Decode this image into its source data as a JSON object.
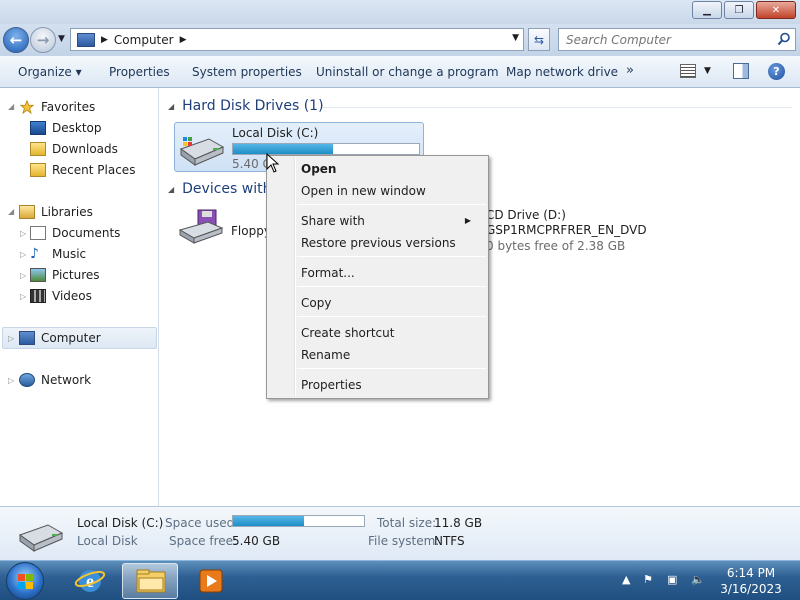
{
  "window": {
    "minimize_glyph": "▁",
    "maximize_glyph": "❐",
    "close_glyph": "✕"
  },
  "address": {
    "path": "Computer",
    "search_placeholder": "Search Computer"
  },
  "toolbar": {
    "organize": "Organize ▾",
    "properties": "Properties",
    "system_properties": "System properties",
    "uninstall": "Uninstall or change a program",
    "map_network": "Map network drive",
    "more": "»",
    "help": "?"
  },
  "sidebar": {
    "favorites": "Favorites",
    "desktop": "Desktop",
    "downloads": "Downloads",
    "recent_places": "Recent Places",
    "libraries": "Libraries",
    "documents": "Documents",
    "music": "Music",
    "pictures": "Pictures",
    "videos": "Videos",
    "computer": "Computer",
    "network": "Network"
  },
  "content": {
    "hdd_group": "Hard Disk Drives (1)",
    "devices_group": "Devices with",
    "local_disk": {
      "name": "Local Disk (C:)",
      "free_text": "5.40 GB",
      "used_fraction": 0.54
    },
    "floppy": "Floppy",
    "cd": {
      "name": "CD Drive (D:)",
      "label": "GSP1RMCPRFRER_EN_DVD",
      "free_text": "0 bytes free of 2.38 GB"
    }
  },
  "context_menu": {
    "open": "Open",
    "open_new_window": "Open in new window",
    "share_with": "Share with",
    "restore": "Restore previous versions",
    "format": "Format...",
    "copy": "Copy",
    "create_shortcut": "Create shortcut",
    "rename": "Rename",
    "properties": "Properties"
  },
  "details": {
    "name": "Local Disk (C:)",
    "type": "Local Disk",
    "space_used_label": "Space used:",
    "space_free_label": "Space free:",
    "space_free_value": "5.40 GB",
    "total_size_label": "Total size:",
    "total_size_value": "11.8 GB",
    "file_system_label": "File system:",
    "file_system_value": "NTFS",
    "used_fraction": 0.54
  },
  "taskbar": {
    "time": "6:14 PM",
    "date": "3/16/2023"
  },
  "colors": {
    "accent": "#1f8ec7",
    "selection": "#cfe1f5"
  }
}
